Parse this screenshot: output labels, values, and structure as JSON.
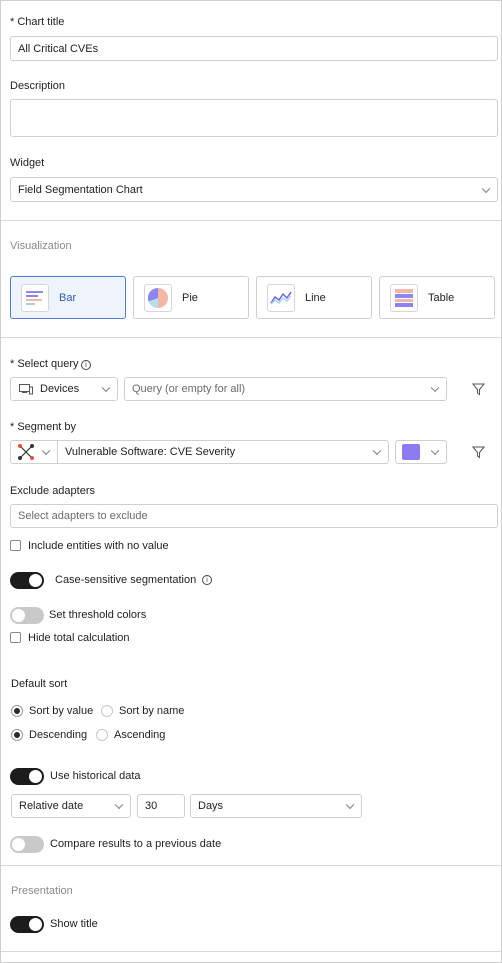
{
  "chart_title": {
    "label": "* Chart title",
    "value": "All Critical CVEs"
  },
  "description": {
    "label": "Description",
    "value": ""
  },
  "widget": {
    "label": "Widget",
    "value": "Field Segmentation Chart"
  },
  "visualization": {
    "title": "Visualization",
    "options": [
      {
        "label": "Bar",
        "icon": "bar-chart-icon",
        "selected": true
      },
      {
        "label": "Pie",
        "icon": "pie-chart-icon",
        "selected": false
      },
      {
        "label": "Line",
        "icon": "line-chart-icon",
        "selected": false
      },
      {
        "label": "Table",
        "icon": "table-icon",
        "selected": false
      }
    ]
  },
  "select_query": {
    "label": "* Select query",
    "entity": "Devices",
    "query_placeholder": "Query (or empty for all)"
  },
  "segment_by": {
    "label": "* Segment by",
    "field": "Vulnerable Software: CVE Severity",
    "color": "#8b7cf0"
  },
  "exclude_adapters": {
    "label": "Exclude adapters",
    "placeholder": "Select adapters to exclude"
  },
  "include_no_value": {
    "label": "Include entities with no value",
    "checked": false
  },
  "case_sensitive": {
    "label": "Case-sensitive segmentation",
    "on": true
  },
  "threshold_colors": {
    "label": "Set threshold colors",
    "on": false
  },
  "hide_total": {
    "label": "Hide total calculation",
    "checked": false
  },
  "default_sort": {
    "label": "Default sort",
    "sort_by_value": "Sort by value",
    "sort_by_name": "Sort by name",
    "descending": "Descending",
    "ascending": "Ascending",
    "selected_sort": "Sort by value",
    "selected_order": "Descending"
  },
  "historical": {
    "label": "Use historical data",
    "on": true,
    "date_mode": "Relative date",
    "amount": "30",
    "unit": "Days"
  },
  "compare": {
    "label": "Compare results to a previous date",
    "on": false
  },
  "presentation": {
    "title": "Presentation",
    "show_title_label": "Show title",
    "show_title_on": true
  },
  "colors": {
    "selected_border": "#4f7fd8",
    "selected_bg": "#eef3fc",
    "toggle_on": "#1c1c1c",
    "toggle_off": "#c9c9c9"
  }
}
